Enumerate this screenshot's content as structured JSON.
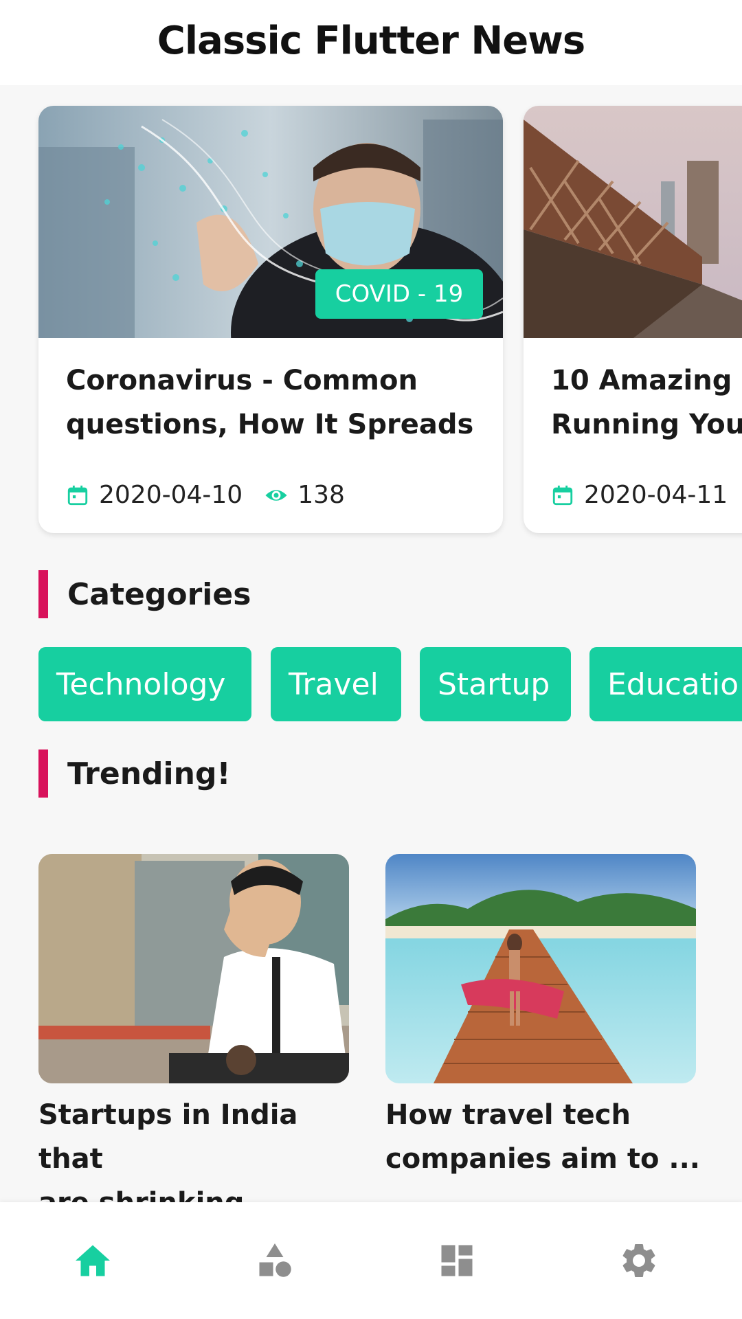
{
  "app": {
    "title": "Classic Flutter News"
  },
  "featured": [
    {
      "badge": "COVID - 19",
      "title_line1": "Coronavirus - Common",
      "title_line2": "questions, How It Spreads",
      "date": "2020-04-10",
      "views": "138"
    },
    {
      "title_line1": "10 Amazing",
      "title_line2": "Running You",
      "date": "2020-04-11"
    }
  ],
  "sections": {
    "categories": "Categories",
    "trending": "Trending!"
  },
  "categories": [
    "Technology",
    "Travel",
    "Startup",
    "Educatio"
  ],
  "trending": [
    {
      "title_line1": "Startups in India that",
      "title_line2": "are shrinking ..."
    },
    {
      "title_line1": "How travel tech",
      "title_line2": "companies aim to ..."
    }
  ],
  "colors": {
    "accent": "#17cfa0",
    "section_bar": "#d8125b",
    "inactive_icon": "#8e8e8e"
  },
  "nav": {
    "items": [
      "home-icon",
      "category-icon",
      "dashboard-icon",
      "settings-icon"
    ]
  }
}
